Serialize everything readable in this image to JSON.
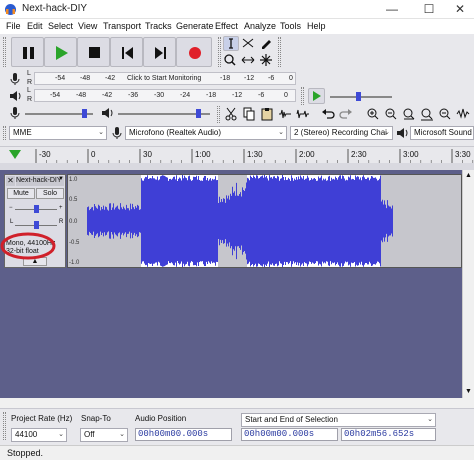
{
  "window": {
    "title": "Next-hack-DIY",
    "minimize_label": "—",
    "maximize_label": "☐",
    "close_label": "✕"
  },
  "menu": [
    "File",
    "Edit",
    "Select",
    "View",
    "Transport",
    "Tracks",
    "Generate",
    "Effect",
    "Analyze",
    "Tools",
    "Help"
  ],
  "meters": {
    "record_channels": [
      "L",
      "R"
    ],
    "record_ticks": [
      "-54",
      "-48",
      "-42"
    ],
    "monitor_label": "Click to Start Monitoring",
    "record_ticks_right": [
      "-18",
      "-12",
      "-6",
      "0"
    ],
    "play_ticks": [
      "-54",
      "-48",
      "-42",
      "-36",
      "-30",
      "-24",
      "-18",
      "-12",
      "-6",
      "0"
    ]
  },
  "devices": {
    "host": "MME",
    "mic": "Microfono (Realtek Audio)",
    "channels": "2 (Stereo) Recording Chai",
    "output": "Microsoft Sound I"
  },
  "timeline": {
    "ticks": [
      "-30",
      "0",
      "30",
      "1:00",
      "1:30",
      "2:00",
      "2:30",
      "3:00",
      "3:30"
    ]
  },
  "track": {
    "name": "Next-hack-DIY",
    "mute": "Mute",
    "solo": "Solo",
    "pan_l": "L",
    "pan_r": "R",
    "info_line1": "Mono, 44100Hz",
    "info_line2": "32-bit float",
    "collapse": "▲",
    "close": "✕",
    "menu_arrow": "▼",
    "scale": [
      "1.0",
      "0.5",
      "0.0",
      "-0.5",
      "-1.0"
    ],
    "wave_color": "#3f3fd6",
    "selected_color": "#ffffff",
    "highlight_circle_color": "#d0202a"
  },
  "selection_toolbar": {
    "project_rate_label": "Project Rate (Hz)",
    "project_rate_value": "44100",
    "snap_label": "Snap-To",
    "snap_value": "Off",
    "audio_position_label": "Audio Position",
    "audio_position_value": "00h00m00.000s",
    "selection_label": "Start and End of Selection",
    "sel_start_value": "00h00m00.000s",
    "sel_end_value": "00h02m56.652s"
  },
  "status": {
    "text": "Stopped."
  }
}
